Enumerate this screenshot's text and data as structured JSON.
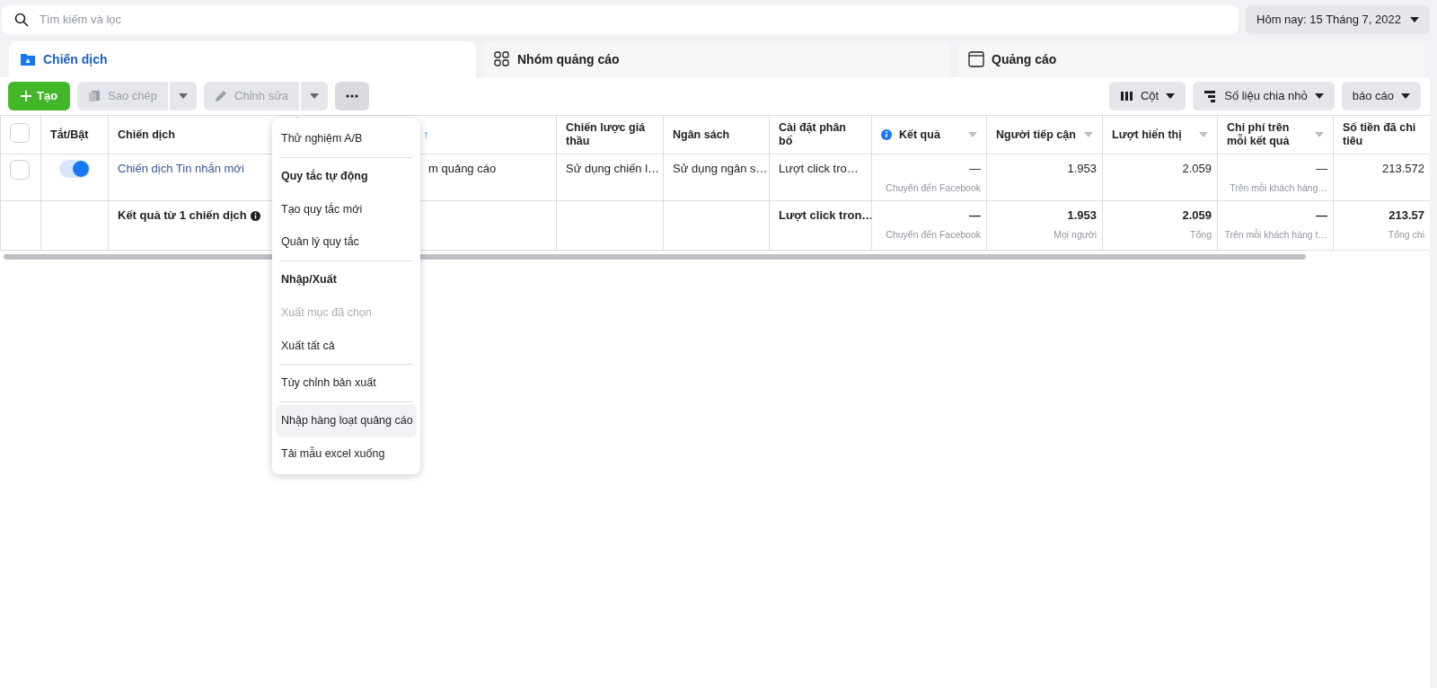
{
  "search": {
    "placeholder": "Tìm kiếm và lọc"
  },
  "date_button": {
    "label": "Hôm nay: 15 Tháng 7, 2022"
  },
  "tabs": [
    {
      "label": "Chiến dịch",
      "selected": true
    },
    {
      "label": "Nhóm quảng cáo",
      "selected": false
    },
    {
      "label": "Quảng cáo",
      "selected": false
    }
  ],
  "toolbar": {
    "create": {
      "label": "Tạo"
    },
    "copy": {
      "label": "Sao chép",
      "disabled": true
    },
    "edit": {
      "label": "Chỉnh sửa",
      "disabled": true
    },
    "more": {
      "expanded": true
    },
    "right_buttons": [
      {
        "label": "Cột"
      },
      {
        "label": "Số liệu chia nhỏ"
      },
      {
        "label": "báo cáo"
      }
    ]
  },
  "table": {
    "columns": [
      {
        "kind": "checkbox",
        "checked": false
      },
      {
        "kind": "plain",
        "label": "Tắt/Bật"
      },
      {
        "kind": "plain",
        "label": "Chiến dịch"
      },
      {
        "kind": "sort",
        "label": "↑"
      },
      {
        "kind": "plain",
        "label": "Chiến lược giá thầu"
      },
      {
        "kind": "plain",
        "label": "Ngân sách"
      },
      {
        "kind": "plain",
        "label": "Cài đặt phân bổ"
      },
      {
        "kind": "info_menu",
        "label": "Kết quả"
      },
      {
        "kind": "menu",
        "label": "Người tiếp cận"
      },
      {
        "kind": "menu",
        "label": "Lượt hiển thị"
      },
      {
        "kind": "menu",
        "label": "Chi phí trên mỗi kết quả"
      },
      {
        "kind": "plain",
        "label": "Số tiền đã chi tiêu"
      }
    ],
    "rows": [
      {
        "kind": "campaign",
        "cells": [
          {
            "kind": "checkbox",
            "checked": false
          },
          {
            "kind": "toggle",
            "on": true
          },
          {
            "text": "Chiến dịch Tin nhắn mới"
          },
          {
            "text": "m quảng cáo"
          },
          {
            "text": "Sử dụng chiến l…"
          },
          {
            "text": "Sử dụng ngân s…"
          },
          {
            "text": "Lượt click tro…"
          },
          {
            "text": "—",
            "sub": "Chuyển đến Facebook"
          },
          {
            "text": "1.953"
          },
          {
            "text": "2.059"
          },
          {
            "text": "—",
            "sub": "Trên mỗi khách hàng…"
          },
          {
            "text": "213.572"
          }
        ]
      },
      {
        "kind": "summary",
        "cells": [
          null,
          null,
          {
            "text": "Kết quả từ 1 chiến dịch",
            "info": true
          },
          null,
          null,
          null,
          {
            "text": "Lượt click tron…"
          },
          {
            "text": "—",
            "sub": "Chuyển đến Facebook"
          },
          {
            "text": "1.953",
            "sub": "Mọi người"
          },
          {
            "text": "2.059",
            "sub": "Tổng"
          },
          {
            "text": "—",
            "sub": "Trên mỗi khách hàng t…"
          },
          {
            "text": "213.57",
            "sub": "Tổng chi"
          }
        ]
      }
    ]
  },
  "menu": {
    "items": [
      {
        "kind": "item",
        "label": "Thử nghiệm A/B",
        "disabled": false,
        "selected": false
      },
      {
        "kind": "divider"
      },
      {
        "kind": "header",
        "label": "Quy tắc tự động"
      },
      {
        "kind": "item",
        "label": "Tạo quy tắc mới",
        "disabled": false,
        "selected": false
      },
      {
        "kind": "item",
        "label": "Quản lý quy tắc",
        "disabled": false,
        "selected": false
      },
      {
        "kind": "divider"
      },
      {
        "kind": "header",
        "label": "Nhập/Xuất"
      },
      {
        "kind": "item",
        "label": "Xuất mục đã chọn",
        "disabled": true,
        "selected": false
      },
      {
        "kind": "item",
        "label": "Xuất tất cả",
        "disabled": false,
        "selected": false
      },
      {
        "kind": "divider"
      },
      {
        "kind": "item",
        "label": "Tùy chỉnh bản xuất",
        "disabled": false,
        "selected": false
      },
      {
        "kind": "divider"
      },
      {
        "kind": "item",
        "label": "Nhập hàng loạt quảng cáo",
        "disabled": false,
        "selected": true
      },
      {
        "kind": "item",
        "label": "Tải mẫu excel xuống",
        "disabled": false,
        "selected": false
      }
    ]
  }
}
